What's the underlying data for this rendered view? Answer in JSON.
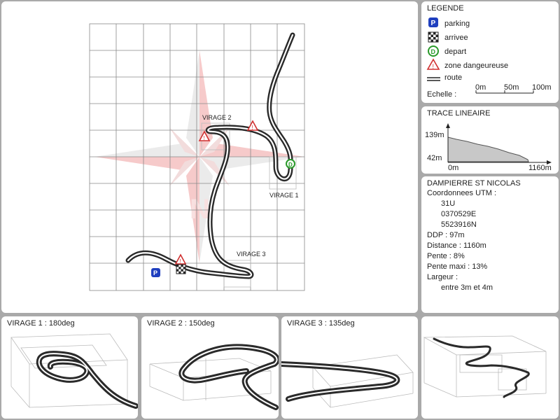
{
  "map": {
    "labels": [
      "VIRAGE 2",
      "VIRAGE 1",
      "VIRAGE 3"
    ]
  },
  "legend": {
    "title": "LEGENDE",
    "items": [
      "parking",
      "arrivee",
      "depart",
      "zone dangeureuse",
      "route"
    ],
    "scale_label": "Echelle :",
    "scale_ticks": [
      "0m",
      "50m",
      "100m"
    ]
  },
  "profile": {
    "title": "TRACE LINEAIRE",
    "y_labels": [
      "139m",
      "42m"
    ],
    "x_labels": [
      "0m",
      "1160m"
    ]
  },
  "info": {
    "title": "DAMPIERRE ST NICOLAS",
    "lines": [
      "Coordonnees UTM :",
      "31U",
      "0370529E",
      "5523916N",
      "DDP : 97m",
      "Distance : 1160m",
      "Pente : 8%",
      "Pente maxi : 13%",
      "Largeur :",
      "entre 3m et 4m"
    ]
  },
  "virages": [
    {
      "title": "VIRAGE 1 : 180deg"
    },
    {
      "title": "VIRAGE 2 : 150deg"
    },
    {
      "title": "VIRAGE 3 : 135deg"
    }
  ]
}
